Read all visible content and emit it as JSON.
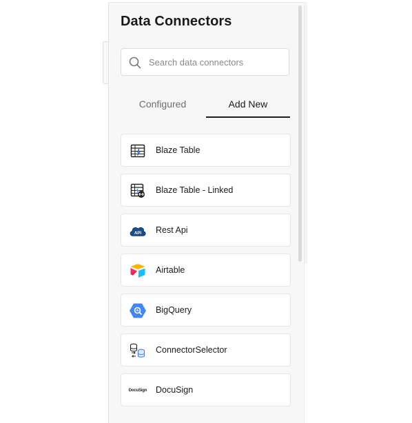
{
  "panel": {
    "title": "Data Connectors"
  },
  "search": {
    "placeholder": "Search data connectors",
    "value": ""
  },
  "tabs": [
    {
      "label": "Configured",
      "active": false
    },
    {
      "label": "Add New",
      "active": true
    }
  ],
  "connectors": [
    {
      "label": "Blaze Table",
      "icon": "table-lightning-icon"
    },
    {
      "label": "Blaze Table - Linked",
      "icon": "table-link-icon"
    },
    {
      "label": "Rest Api",
      "icon": "api-cloud-icon"
    },
    {
      "label": "Airtable",
      "icon": "airtable-icon"
    },
    {
      "label": "BigQuery",
      "icon": "bigquery-icon"
    },
    {
      "label": "ConnectorSelector",
      "icon": "database-selector-icon"
    },
    {
      "label": "DocuSign",
      "icon": "docusign-icon",
      "logo_text": "DocuSign"
    }
  ],
  "colors": {
    "panel_bg": "#f7f7f7",
    "active_tab_underline": "#1f1f1f",
    "inactive_tab_text": "#6e6e6e",
    "rest_api_blue": "#1b4f8c",
    "bigquery_blue": "#4285f4"
  }
}
